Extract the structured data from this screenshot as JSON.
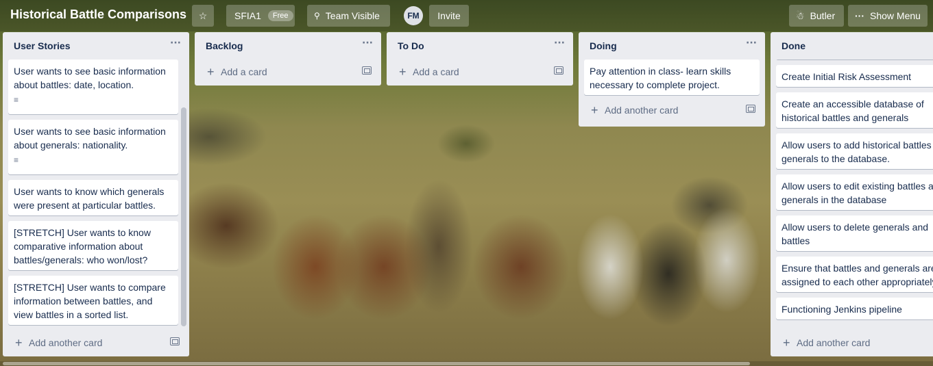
{
  "header": {
    "board_title": "Historical Battle Comparisons",
    "workspace_name": "SFIA1",
    "workspace_badge": "Free",
    "visibility_label": "Team Visible",
    "avatar_initials": "FM",
    "invite_label": "Invite",
    "butler_label": "Butler",
    "show_menu_label": "Show Menu"
  },
  "lists": [
    {
      "title": "User Stories",
      "menu": "···",
      "cards": [
        {
          "text": "User wants to see basic information about battles: date, location.",
          "has_description": true
        },
        {
          "text": "User wants to see basic information about generals: nationality.",
          "has_description": true
        },
        {
          "text": "User wants to know which generals were present at particular battles.",
          "has_description": false
        },
        {
          "text": "[STRETCH] User wants to know comparative information about battles/generals: who won/lost?",
          "has_description": false
        },
        {
          "text": "[STRETCH] User wants to compare information between battles, and view battles in a sorted list.",
          "has_description": false
        }
      ],
      "add_label": "Add another card"
    },
    {
      "title": "Backlog",
      "menu": "···",
      "cards": [],
      "add_label": "Add a card"
    },
    {
      "title": "To Do",
      "menu": "···",
      "cards": [],
      "add_label": "Add a card"
    },
    {
      "title": "Doing",
      "menu": "···",
      "cards": [
        {
          "text": "Pay attention in class- learn skills necessary to complete project.",
          "has_description": false
        }
      ],
      "add_label": "Add another card"
    },
    {
      "title": "Done",
      "menu": "···",
      "cards": [
        {
          "text": "Create Initial Risk Assessment"
        },
        {
          "text": "Create an accessible database of historical battles and generals"
        },
        {
          "text": "Allow users to add historical battles and generals to the database."
        },
        {
          "text": "Allow users to edit existing battles and generals in the database"
        },
        {
          "text": "Allow users to delete generals and battles"
        },
        {
          "text": "Ensure that battles and generals are assigned to each other appropriately"
        },
        {
          "text": "Functioning Jenkins pipeline"
        }
      ],
      "add_label": "Add another card"
    }
  ],
  "icons": {
    "star": "star-icon",
    "team": "team-icon",
    "butler": "butler-icon",
    "menu": "ellipsis-icon",
    "description": "description-icon",
    "template": "card-template-icon"
  }
}
